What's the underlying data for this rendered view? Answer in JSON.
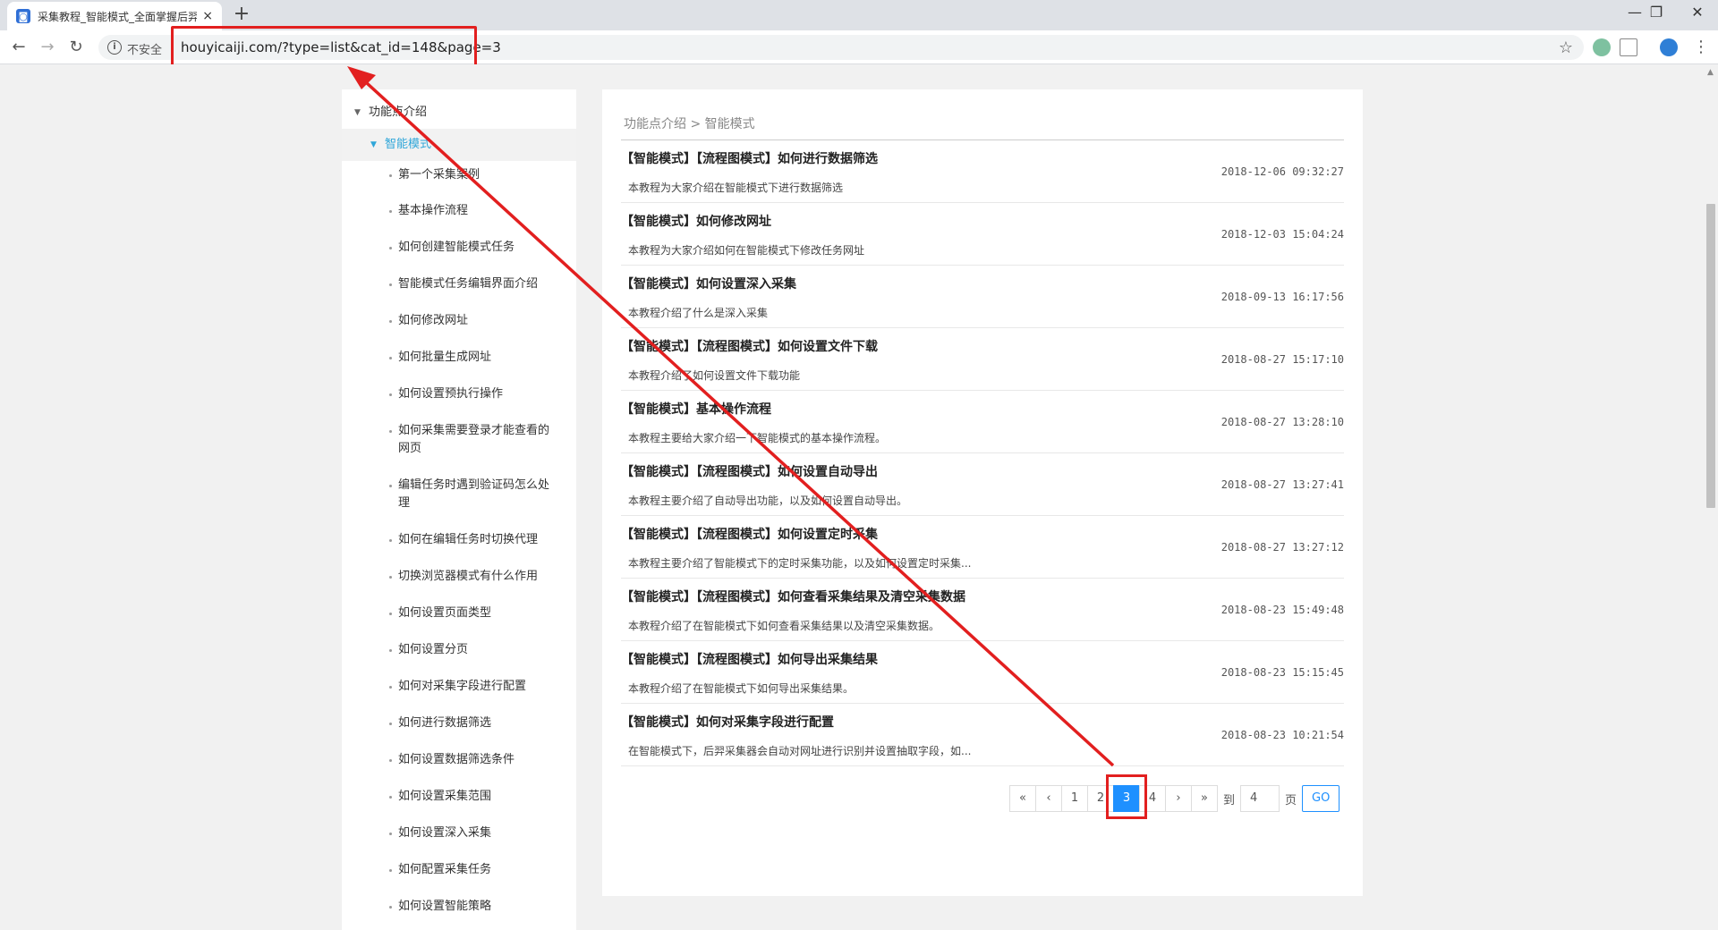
{
  "browser": {
    "tab_title": "采集教程_智能模式_全面掌握后羿",
    "tab_close": "×",
    "new_tab": "+",
    "win_minimize": "—",
    "win_restore": "❐",
    "win_close": "✕",
    "back": "←",
    "forward": "→",
    "reload": "↻",
    "info": "i",
    "insecure_label": "不安全",
    "url": "houyicaiji.com/?type=list&cat_id=148&page=3",
    "star": "☆",
    "menu": "⋮"
  },
  "sidebar": {
    "parent": "功能点介绍",
    "active": "智能模式",
    "items": [
      "第一个采集案例",
      "基本操作流程",
      "如何创建智能模式任务",
      "智能模式任务编辑界面介绍",
      "如何修改网址",
      "如何批量生成网址",
      "如何设置预执行操作",
      "如何采集需要登录才能查看的网页",
      "编辑任务时遇到验证码怎么处理",
      "如何在编辑任务时切换代理",
      "切换浏览器模式有什么作用",
      "如何设置页面类型",
      "如何设置分页",
      "如何对采集字段进行配置",
      "如何进行数据筛选",
      "如何设置数据筛选条件",
      "如何设置采集范围",
      "如何设置深入采集",
      "如何配置采集任务",
      "如何设置智能策略"
    ]
  },
  "main": {
    "breadcrumb": "功能点介绍 > 智能模式",
    "articles": [
      {
        "title": "【智能模式】【流程图模式】如何进行数据筛选",
        "date": "2018-12-06 09:32:27",
        "desc": "本教程为大家介绍在智能模式下进行数据筛选"
      },
      {
        "title": "【智能模式】如何修改网址",
        "date": "2018-12-03 15:04:24",
        "desc": "本教程为大家介绍如何在智能模式下修改任务网址"
      },
      {
        "title": "【智能模式】如何设置深入采集",
        "date": "2018-09-13 16:17:56",
        "desc": "本教程介绍了什么是深入采集"
      },
      {
        "title": "【智能模式】【流程图模式】如何设置文件下载",
        "date": "2018-08-27 15:17:10",
        "desc": "本教程介绍了如何设置文件下载功能"
      },
      {
        "title": "【智能模式】基本操作流程",
        "date": "2018-08-27 13:28:10",
        "desc": "本教程主要给大家介绍一下智能模式的基本操作流程。"
      },
      {
        "title": "【智能模式】【流程图模式】如何设置自动导出",
        "date": "2018-08-27 13:27:41",
        "desc": "本教程主要介绍了自动导出功能，以及如何设置自动导出。"
      },
      {
        "title": "【智能模式】【流程图模式】如何设置定时采集",
        "date": "2018-08-27 13:27:12",
        "desc": "本教程主要介绍了智能模式下的定时采集功能，以及如何设置定时采集..."
      },
      {
        "title": "【智能模式】【流程图模式】如何查看采集结果及清空采集数据",
        "date": "2018-08-23 15:49:48",
        "desc": "本教程介绍了在智能模式下如何查看采集结果以及清空采集数据。"
      },
      {
        "title": "【智能模式】【流程图模式】如何导出采集结果",
        "date": "2018-08-23 15:15:45",
        "desc": "本教程介绍了在智能模式下如何导出采集结果。"
      },
      {
        "title": "【智能模式】如何对采集字段进行配置",
        "date": "2018-08-23 10:21:54",
        "desc": "在智能模式下，后羿采集器会自动对网址进行识别并设置抽取字段，如..."
      }
    ]
  },
  "pager": {
    "first": "«",
    "prev": "‹",
    "pages": [
      "1",
      "2",
      "3",
      "4"
    ],
    "current": "3",
    "next": "›",
    "last": "»",
    "to_label": "到",
    "input_value": "4",
    "page_label": "页",
    "go": "GO"
  }
}
